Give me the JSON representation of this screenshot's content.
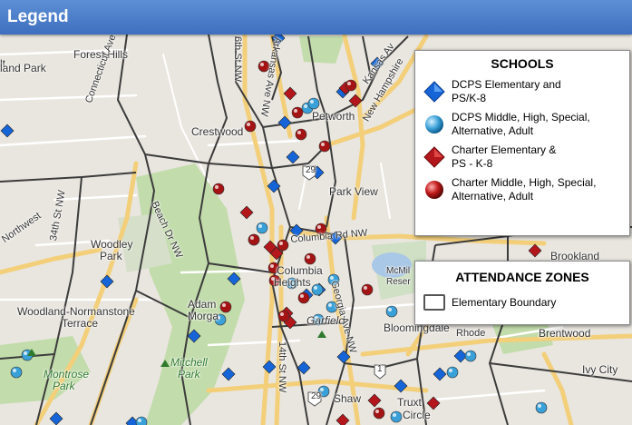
{
  "header": {
    "title": "Legend"
  },
  "schools_legend": {
    "title": "SCHOOLS",
    "items": [
      {
        "symbol": "blue-diamond-icon",
        "label_line1": "DCPS Elementary and",
        "label_line2": "PS/K-8"
      },
      {
        "symbol": "blue-circle-icon",
        "label_line1": "DCPS Middle, High, Special,",
        "label_line2": "Alternative, Adult"
      },
      {
        "symbol": "red-diamond-icon",
        "label_line1": "Charter Elementary &",
        "label_line2": "PS - K-8"
      },
      {
        "symbol": "red-circle-icon",
        "label_line1": "Charter Middle, High, Special,",
        "label_line2": "Alternative, Adult"
      }
    ]
  },
  "zones_legend": {
    "title": "ATTENDANCE ZONES",
    "items": [
      {
        "symbol": "boundary-box-icon",
        "label": "Elementary Boundary"
      }
    ]
  },
  "map_labels": {
    "lt": "lt",
    "land_park": "land Park",
    "forest_hills": "Forest Hills",
    "crestwood": "Crestwood",
    "petworth": "Petworth",
    "park_view": "Park View",
    "woodley_park_1": "Woodley",
    "woodley_park_2": "Park",
    "columbia_heights_1": "Columbia",
    "columbia_heights_2": "Heights",
    "adams_morgan_1": "Adam",
    "adams_morgan_2": "Morga",
    "woodland": "Woodland-Normanstone",
    "terrace": "Terrace",
    "mitchell_park_1": "Mitchell",
    "mitchell_park_2": "Park",
    "montrose_1": "Montrose",
    "montrose_2": "Park",
    "garfield": "Garfield",
    "shaw": "Shaw",
    "bloomingdale": "Bloomingdale",
    "brookland": "Brookland",
    "brentwood": "Brentwood",
    "ivy_city": "Ivy City",
    "truxton_1": "Truxt",
    "truxton_2": "Circle",
    "mcmillan_1": "McMil",
    "mcmillan_2": "Reser",
    "road_6th": "6th St NW",
    "road_arkansas": "Arkansas Ave NW",
    "road_kansas": "Kansas Av",
    "road_new_hampshire": "New Hampshire",
    "road_connecticut": "Connecticut Ave NW",
    "road_34th": "34th St NW",
    "road_northwest": "Northwest",
    "road_columbia": "Columbia Rd NW",
    "road_georgia": "Georgia Ave NW",
    "road_14th": "14th St NW",
    "road_beach": "Beach Dr NW",
    "road_rhode": "Rhode",
    "road_29": "29",
    "road_1": "1"
  },
  "colors": {
    "dcps_elementary": "#1565d8",
    "dcps_secondary": "#3aa0d8",
    "charter_elementary": "#b3161b",
    "charter_secondary": "#a51414",
    "boundary": "#3c3c3c",
    "park": "#b7d6a0",
    "road": "#f3cf7a",
    "water": "#a9c7e6"
  }
}
